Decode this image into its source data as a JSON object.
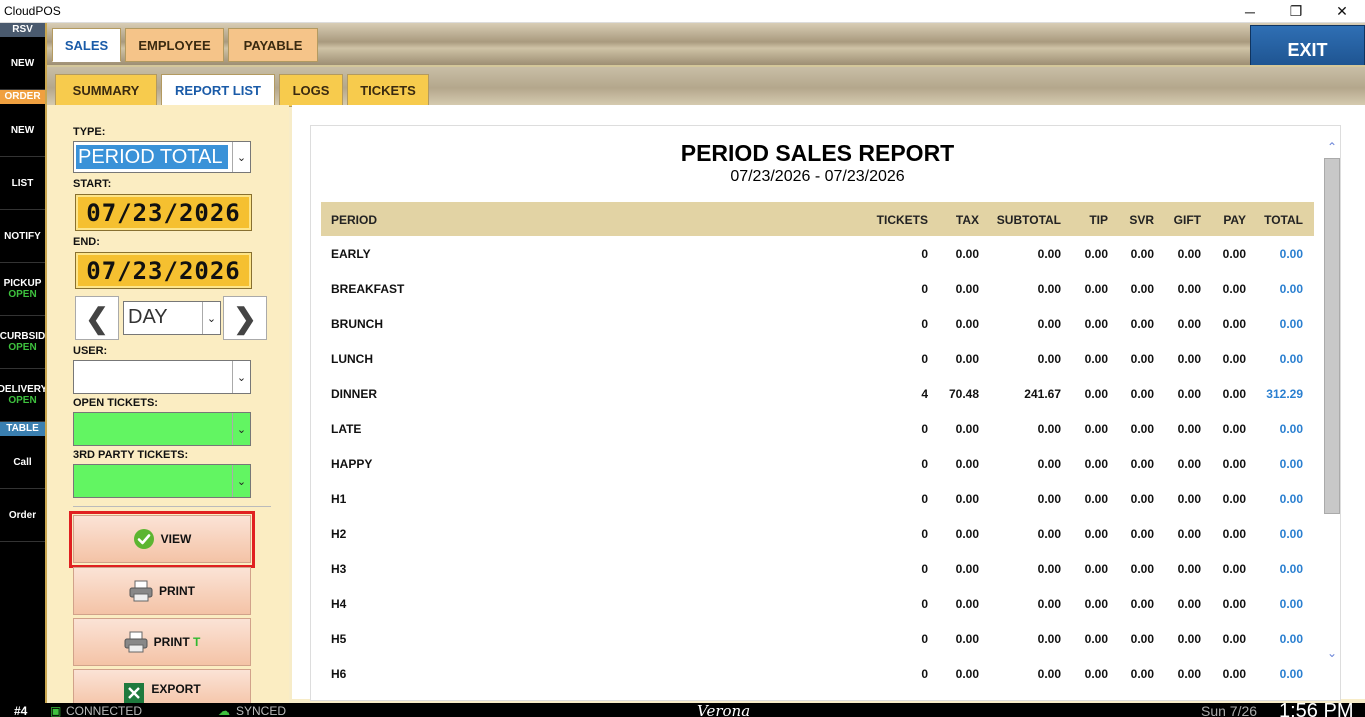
{
  "window": {
    "title": "CloudPOS",
    "minimize": "─",
    "maximize": "❐",
    "close": "✕"
  },
  "sidebar": {
    "rsv_header": "RSV",
    "new1": "NEW",
    "order_header": "ORDER",
    "new2": "NEW",
    "list": "LIST",
    "notify": "NOTIFY",
    "pickup": "PICKUP",
    "pickup_status": "OPEN",
    "curbside": "CURBSID",
    "curbside_status": "OPEN",
    "delivery": "DELIVERY",
    "delivery_status": "OPEN",
    "table_header": "TABLE",
    "call": "Call",
    "order": "Order"
  },
  "tabs_top": [
    "SALES",
    "EMPLOYEE",
    "PAYABLE"
  ],
  "tabs_sub": [
    "SUMMARY",
    "REPORT LIST",
    "LOGS",
    "TICKETS"
  ],
  "exit_label": "EXIT",
  "controls": {
    "type_label": "TYPE:",
    "type_value": "PERIOD TOTAL",
    "start_label": "START:",
    "start_value": "07/23/2026",
    "end_label": "END:",
    "end_value": "07/23/2026",
    "period_value": "DAY",
    "user_label": "USER:",
    "open_tickets_label": "OPEN TICKETS:",
    "third_party_label": "3RD PARTY TICKETS:",
    "view_label": "VIEW",
    "print_label": "PRINT",
    "print_t_label": "PRINT",
    "print_t_suffix": "T",
    "export_label": "EXPORT"
  },
  "report": {
    "title": "PERIOD SALES REPORT",
    "date_range": "07/23/2026 - 07/23/2026",
    "columns": [
      "PERIOD",
      "TICKETS",
      "TAX",
      "SUBTOTAL",
      "TIP",
      "SVR",
      "GIFT",
      "PAY",
      "TOTAL"
    ],
    "rows": [
      [
        "EARLY",
        "0",
        "0.00",
        "0.00",
        "0.00",
        "0.00",
        "0.00",
        "0.00",
        "0.00"
      ],
      [
        "BREAKFAST",
        "0",
        "0.00",
        "0.00",
        "0.00",
        "0.00",
        "0.00",
        "0.00",
        "0.00"
      ],
      [
        "BRUNCH",
        "0",
        "0.00",
        "0.00",
        "0.00",
        "0.00",
        "0.00",
        "0.00",
        "0.00"
      ],
      [
        "LUNCH",
        "0",
        "0.00",
        "0.00",
        "0.00",
        "0.00",
        "0.00",
        "0.00",
        "0.00"
      ],
      [
        "DINNER",
        "4",
        "70.48",
        "241.67",
        "0.00",
        "0.00",
        "0.00",
        "0.00",
        "312.29"
      ],
      [
        "LATE",
        "0",
        "0.00",
        "0.00",
        "0.00",
        "0.00",
        "0.00",
        "0.00",
        "0.00"
      ],
      [
        "HAPPY",
        "0",
        "0.00",
        "0.00",
        "0.00",
        "0.00",
        "0.00",
        "0.00",
        "0.00"
      ],
      [
        "H1",
        "0",
        "0.00",
        "0.00",
        "0.00",
        "0.00",
        "0.00",
        "0.00",
        "0.00"
      ],
      [
        "H2",
        "0",
        "0.00",
        "0.00",
        "0.00",
        "0.00",
        "0.00",
        "0.00",
        "0.00"
      ],
      [
        "H3",
        "0",
        "0.00",
        "0.00",
        "0.00",
        "0.00",
        "0.00",
        "0.00",
        "0.00"
      ],
      [
        "H4",
        "0",
        "0.00",
        "0.00",
        "0.00",
        "0.00",
        "0.00",
        "0.00",
        "0.00"
      ],
      [
        "H5",
        "0",
        "0.00",
        "0.00",
        "0.00",
        "0.00",
        "0.00",
        "0.00",
        "0.00"
      ],
      [
        "H6",
        "0",
        "0.00",
        "0.00",
        "0.00",
        "0.00",
        "0.00",
        "0.00",
        "0.00"
      ]
    ]
  },
  "statusbar": {
    "terminal": "#4",
    "connected": "CONNECTED",
    "synced": "SYNCED",
    "location": "Verona",
    "date": "Sun 7/26",
    "time": "1:56 PM"
  },
  "colors": {
    "accent": "#1a5ba8",
    "total_text": "#2a7fd0",
    "highlight_border": "#e02020",
    "exit_bg": "#1b4f8a"
  }
}
